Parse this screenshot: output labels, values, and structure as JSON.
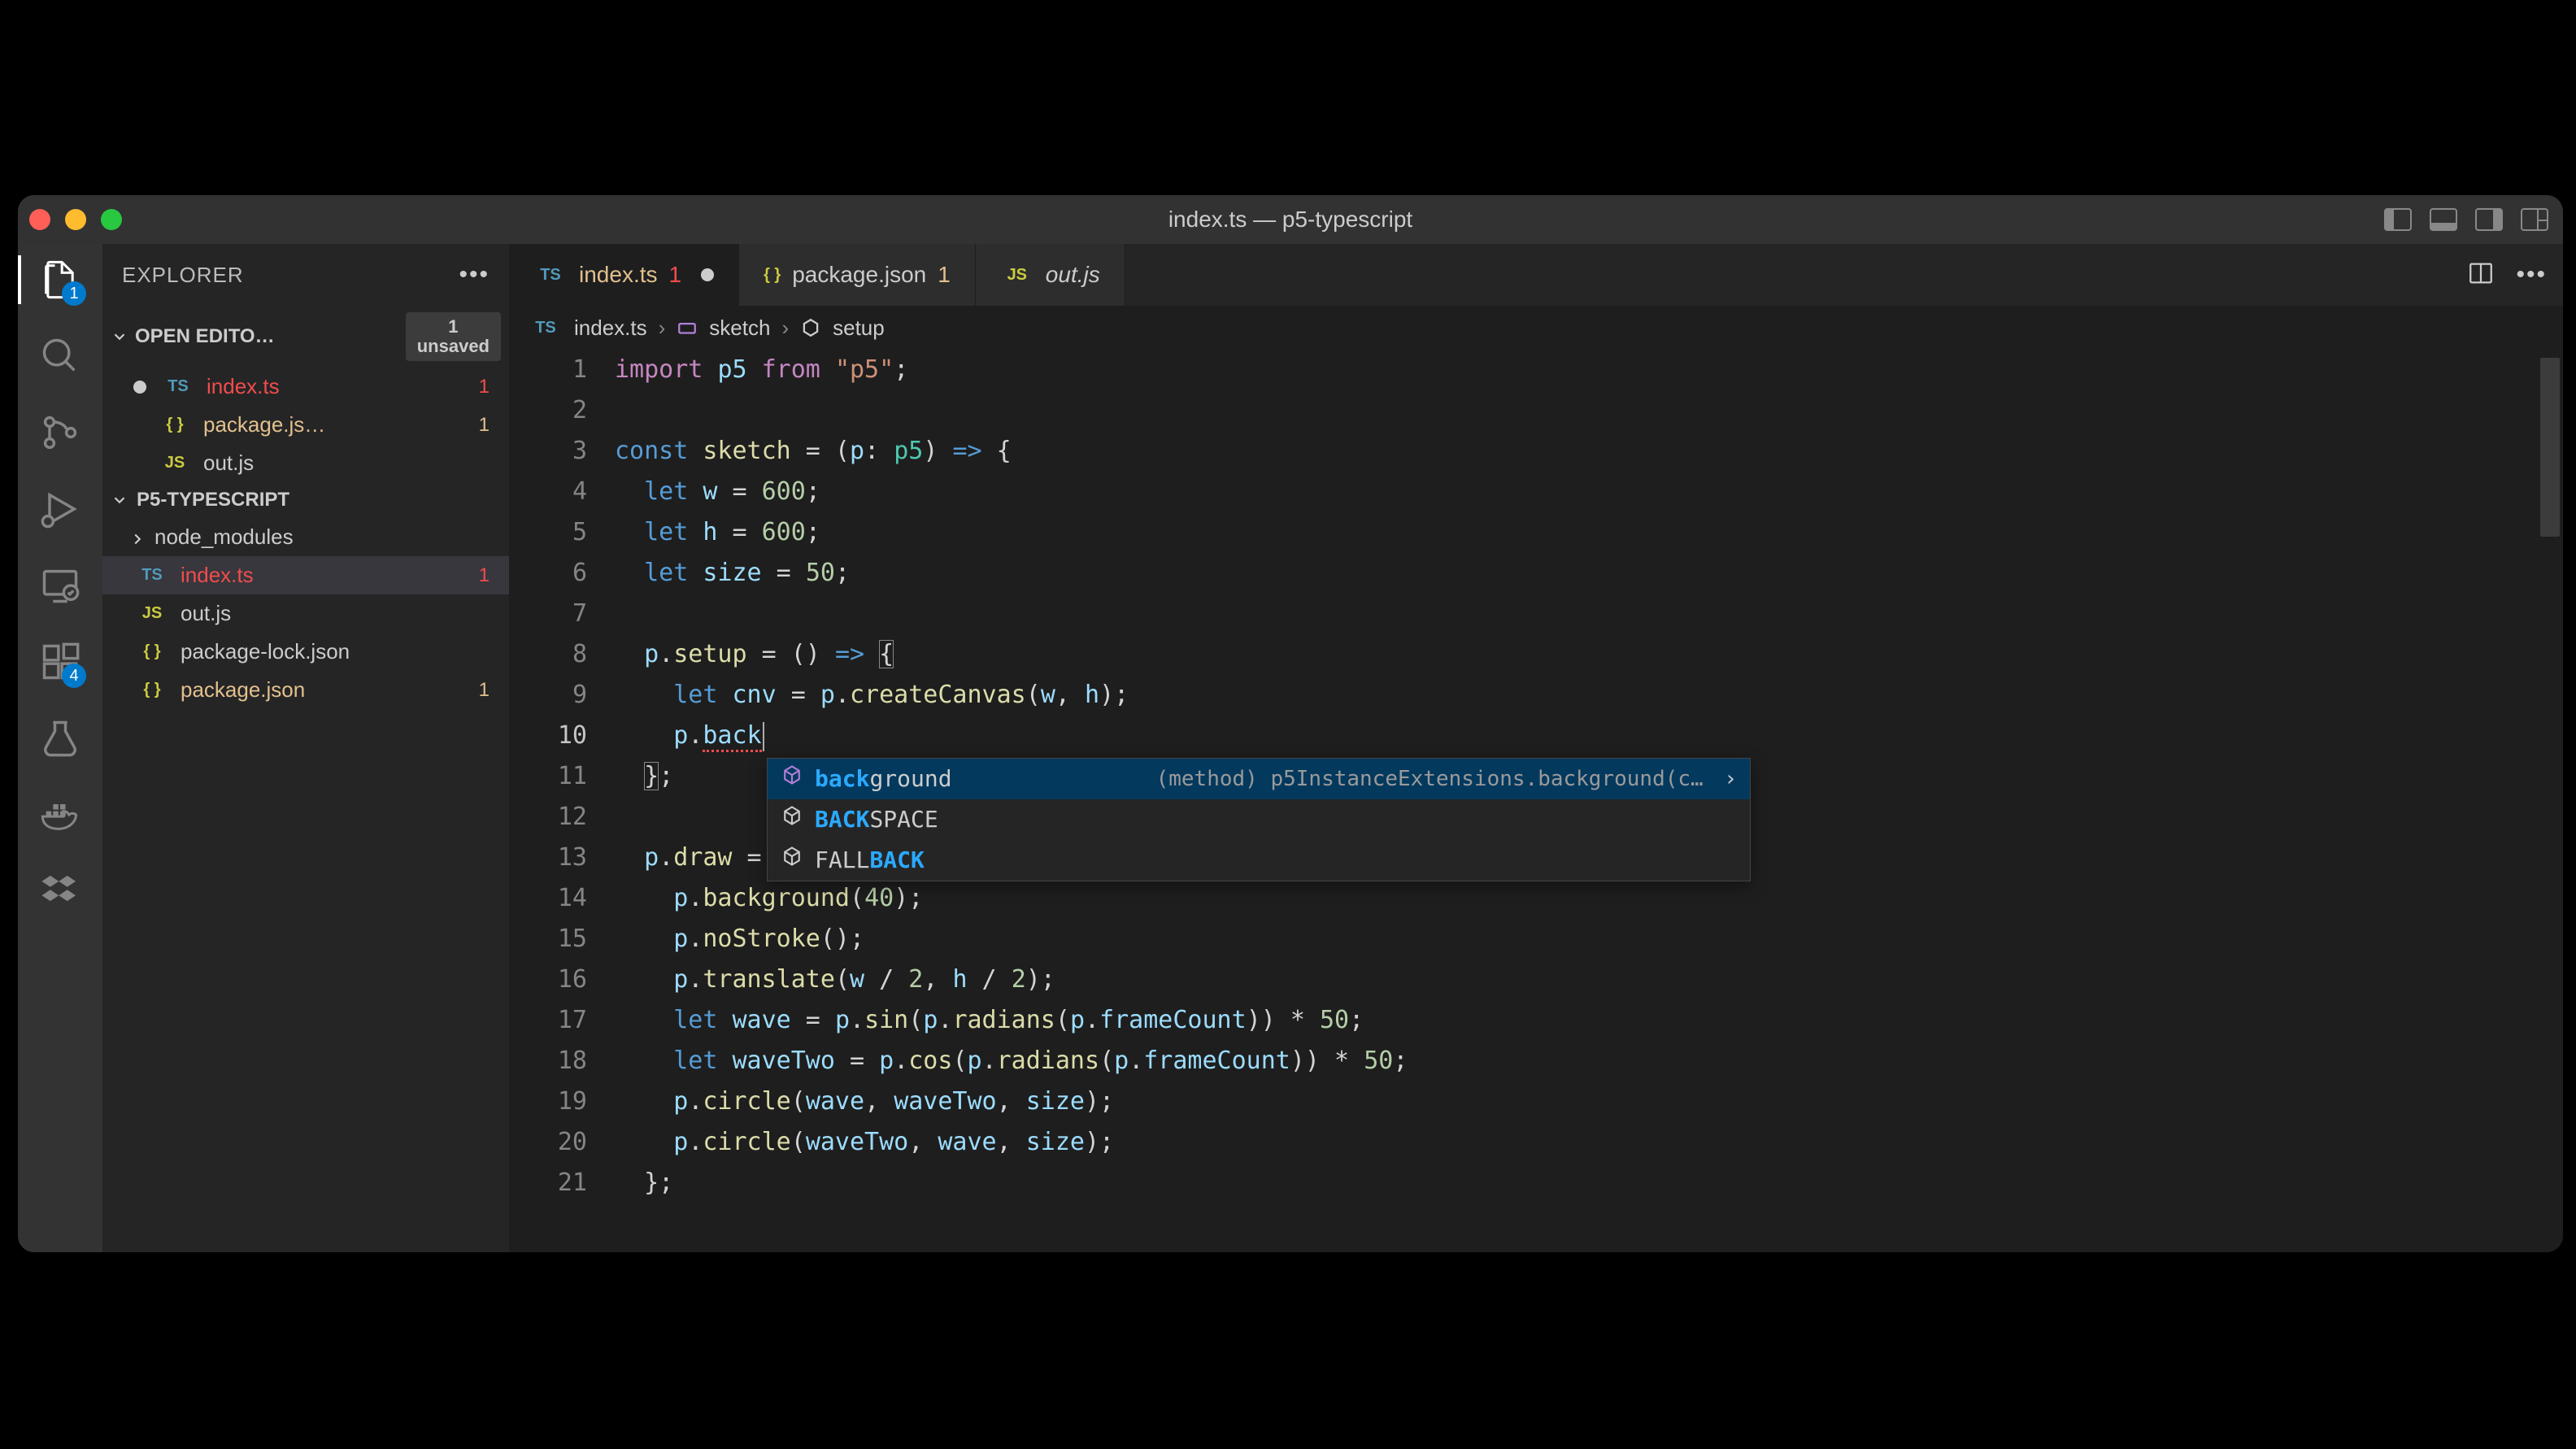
{
  "window_title": "index.ts — p5-typescript",
  "explorer": {
    "title": "EXPLORER"
  },
  "open_editors": {
    "label": "OPEN EDITO…",
    "unsaved_count": "1",
    "unsaved_label": "unsaved",
    "items": [
      {
        "lang": "TS",
        "name": "index.ts",
        "status": "err",
        "badge": "1",
        "dirty": true
      },
      {
        "lang": "{}",
        "name": "package.js…",
        "status": "git-m",
        "badge": "1",
        "dirty": false
      },
      {
        "lang": "JS",
        "name": "out.js",
        "status": "plain",
        "badge": "",
        "dirty": false
      }
    ]
  },
  "project": {
    "name": "P5-TYPESCRIPT",
    "folders": [
      {
        "name": "node_modules"
      }
    ],
    "files": [
      {
        "lang": "TS",
        "name": "index.ts",
        "status": "err",
        "badge": "1",
        "selected": true
      },
      {
        "lang": "JS",
        "name": "out.js",
        "status": "plain",
        "badge": ""
      },
      {
        "lang": "{}",
        "name": "package-lock.json",
        "status": "plain",
        "badge": ""
      },
      {
        "lang": "{}",
        "name": "package.json",
        "status": "git-m",
        "badge": "1"
      }
    ]
  },
  "tabs": [
    {
      "lang": "TS",
      "label": "index.ts",
      "status": "err",
      "badge": "1",
      "dirty": true,
      "active": true
    },
    {
      "lang": "{}",
      "label": "package.json",
      "status": "git-m",
      "badge": "1",
      "dirty": false,
      "active": false
    },
    {
      "lang": "JS",
      "label": "out.js",
      "status": "plain",
      "badge": "",
      "dirty": false,
      "active": false
    }
  ],
  "breadcrumb": {
    "file_lang": "TS",
    "file": "index.ts",
    "sym1": "sketch",
    "sym2": "setup"
  },
  "activity_badges": {
    "explorer": "1",
    "extensions": "4"
  },
  "code_lines": [
    "import p5 from \"p5\";",
    "",
    "const sketch = (p: p5) => {",
    "  let w = 600;",
    "  let h = 600;",
    "  let size = 50;",
    "",
    "  p.setup = () => {",
    "    let cnv = p.createCanvas(w, h);",
    "    p.back",
    "  };",
    "",
    "  p.draw = ",
    "    p.background(40);",
    "    p.noStroke();",
    "    p.translate(w / 2, h / 2);",
    "    let wave = p.sin(p.radians(p.frameCount)) * 50;",
    "    let waveTwo = p.cos(p.radians(p.frameCount)) * 50;",
    "    p.circle(wave, waveTwo, size);",
    "    p.circle(waveTwo, wave, size);",
    "  };"
  ],
  "current_line": 10,
  "suggest": {
    "items": [
      {
        "match": "back",
        "rest": "ground",
        "detail": "(method) p5InstanceExtensions.background(c…",
        "selected": true
      },
      {
        "match": "BACK",
        "rest": "SPACE",
        "detail": "",
        "selected": false
      },
      {
        "prefix": "FALL",
        "match": "BACK",
        "rest": "",
        "detail": "",
        "selected": false
      }
    ]
  }
}
